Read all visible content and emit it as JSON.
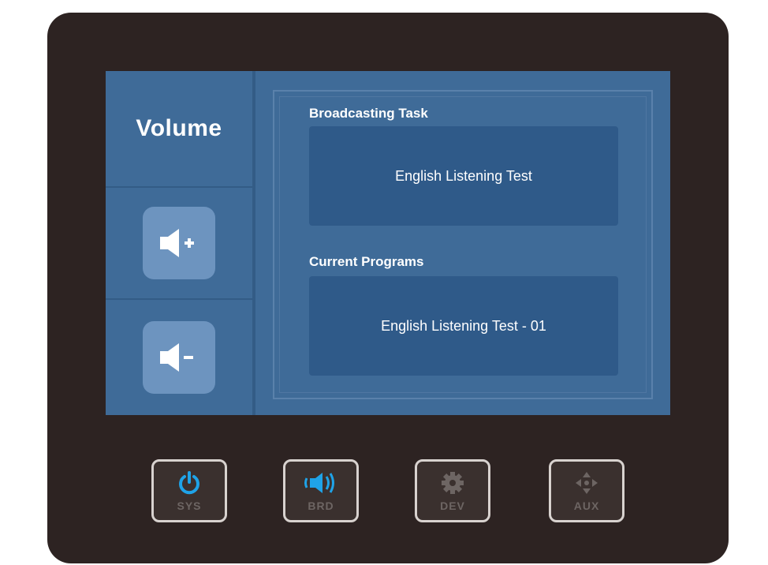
{
  "sidebar": {
    "title": "Volume",
    "volume_up_icon": "speaker-plus-icon",
    "volume_down_icon": "speaker-minus-icon"
  },
  "main": {
    "broadcasting_task": {
      "label": "Broadcasting Task",
      "value": "English Listening Test"
    },
    "current_programs": {
      "label": "Current Programs",
      "value": "English Listening Test - 01"
    }
  },
  "hardware_buttons": [
    {
      "label": "SYS",
      "icon": "power-icon",
      "icon_color": "#1fa3e8"
    },
    {
      "label": "BRD",
      "icon": "broadcast-icon",
      "icon_color": "#1fa3e8"
    },
    {
      "label": "DEV",
      "icon": "gear-icon",
      "icon_color": "#6d6563"
    },
    {
      "label": "AUX",
      "icon": "dpad-icon",
      "icon_color": "#6d6563"
    }
  ],
  "colors": {
    "device_body": "#2d2322",
    "screen_bg": "#3f6b98",
    "info_box_bg": "#2f5a89",
    "button_bg": "#6d94bf",
    "accent_blue": "#1fa3e8"
  }
}
